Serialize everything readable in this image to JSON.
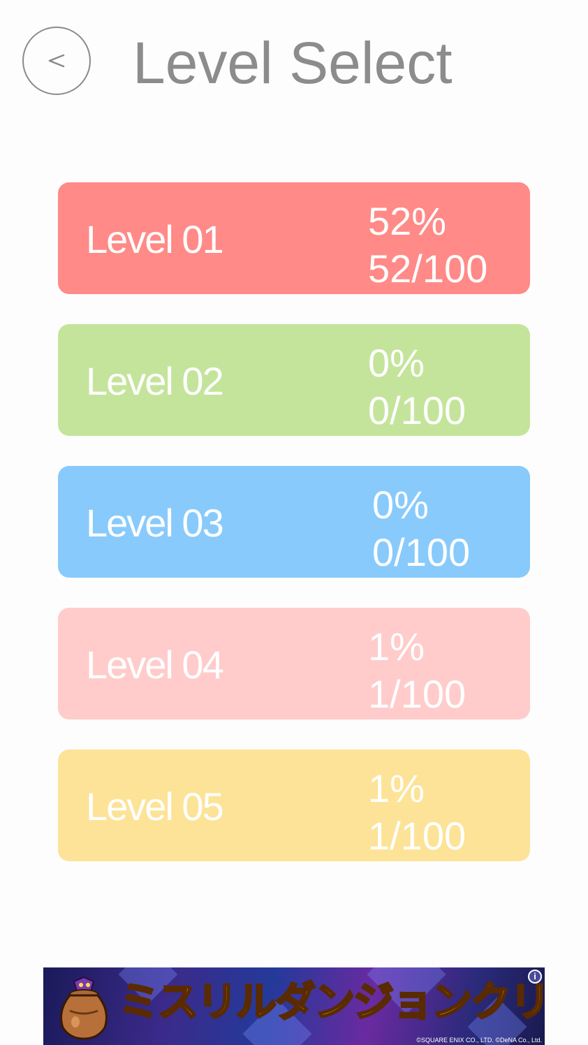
{
  "header": {
    "back_icon": "chevron-left-icon",
    "back_symbol": "<",
    "title": "Level Select"
  },
  "levels": [
    {
      "name": "Level 01",
      "percent": "52%",
      "progress": "52/100",
      "color": "#ff8a87"
    },
    {
      "name": "Level 02",
      "percent": "0%",
      "progress": "0/100",
      "color": "#c4e49b"
    },
    {
      "name": "Level 03",
      "percent": "0%",
      "progress": "0/100",
      "color": "#88cafc"
    },
    {
      "name": "Level 04",
      "percent": "1%",
      "progress": "1/100",
      "color": "#ffcccb"
    },
    {
      "name": "Level 05",
      "percent": "1%",
      "progress": "1/100",
      "color": "#fde398"
    }
  ],
  "ad": {
    "text": "ミスリルダンジョンクリアで",
    "copyright": "©SQUARE ENIX CO., LTD. ©DeNA Co., Ltd.",
    "info_icon": "info-icon",
    "info_symbol": "i",
    "mascot_icon": "treasure-pot-icon"
  }
}
